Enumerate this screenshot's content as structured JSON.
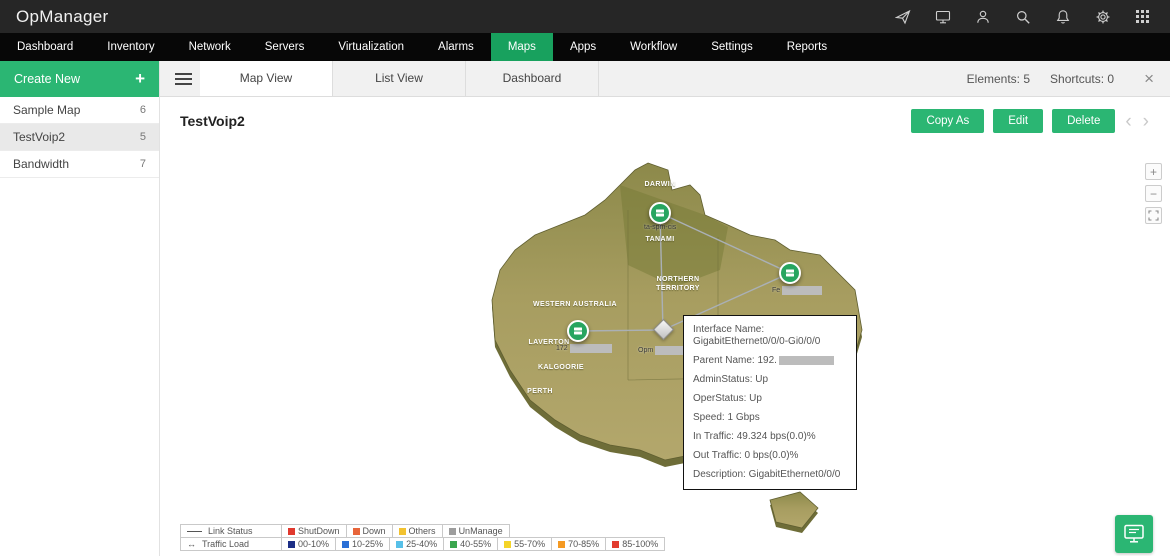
{
  "app": {
    "logo": "OpManager"
  },
  "topbar": {
    "icons": [
      "send-icon",
      "remote-control-icon",
      "user-icon",
      "search-icon",
      "bell-icon",
      "gear-icon",
      "apps-grid-icon"
    ]
  },
  "nav": {
    "items": [
      "Dashboard",
      "Inventory",
      "Network",
      "Servers",
      "Virtualization",
      "Alarms",
      "Maps",
      "Apps",
      "Workflow",
      "Settings",
      "Reports"
    ],
    "active": "Maps",
    "active_color": "#18a15e"
  },
  "sidebar": {
    "create_label": "Create New",
    "plus": "+",
    "items": [
      {
        "label": "Sample Map",
        "count": "6"
      },
      {
        "label": "TestVoip2",
        "count": "5"
      },
      {
        "label": "Bandwidth",
        "count": "7"
      }
    ],
    "selected": "TestVoip2"
  },
  "subheader": {
    "tabs": [
      "Map View",
      "List View",
      "Dashboard"
    ],
    "active_tab": "Map View",
    "elements": "Elements: 5",
    "shortcuts": "Shortcuts: 0",
    "close": "×"
  },
  "view": {
    "title": "TestVoip2",
    "buttons": [
      "Copy As",
      "Edit",
      "Delete"
    ],
    "prev": "‹",
    "next": "›"
  },
  "map": {
    "regions": [
      "DARWIN",
      "TANAMI",
      "NORTHERN TERRITORY",
      "WESTERN AUSTRALIA",
      "LAVERTON",
      "KALGOORIE",
      "PERTH"
    ],
    "nodes": {
      "darwin": "ta-spm-cis",
      "east": "Fe",
      "west": "172",
      "center": "Opm"
    },
    "node_color": "#27a560",
    "land_color": "#a79d60"
  },
  "tooltip": {
    "interface_name": "Interface Name: GigabitEthernet0/0/0-Gi0/0/0",
    "parent_name": "Parent Name: 192.",
    "admin_status": "AdminStatus: Up",
    "oper_status": "OperStatus: Up",
    "speed": "Speed: 1 Gbps",
    "in_traffic": "In Traffic: 49.324 bps(0.0)%",
    "out_traffic": "Out Traffic: 0 bps(0.0)%",
    "description": "Description: GigabitEthernet0/0/0"
  },
  "zoom": {
    "in": "+",
    "out": "−"
  },
  "legend": {
    "link_status": {
      "label": "Link Status",
      "items": [
        {
          "label": "ShutDown",
          "color": "#e0392e"
        },
        {
          "label": "Down",
          "color": "#e8653a"
        },
        {
          "label": "Others",
          "color": "#f2c230"
        },
        {
          "label": "UnManage",
          "color": "#9d9d9d"
        }
      ]
    },
    "traffic_load": {
      "label": "Traffic Load",
      "items": [
        {
          "label": "00-10%",
          "color": "#1c2e86"
        },
        {
          "label": "10-25%",
          "color": "#2a6fd6"
        },
        {
          "label": "25-40%",
          "color": "#57c0e8"
        },
        {
          "label": "40-55%",
          "color": "#3aa64e"
        },
        {
          "label": "55-70%",
          "color": "#f4d428"
        },
        {
          "label": "70-85%",
          "color": "#f59a23"
        },
        {
          "label": "85-100%",
          "color": "#e23c2f"
        }
      ]
    }
  }
}
